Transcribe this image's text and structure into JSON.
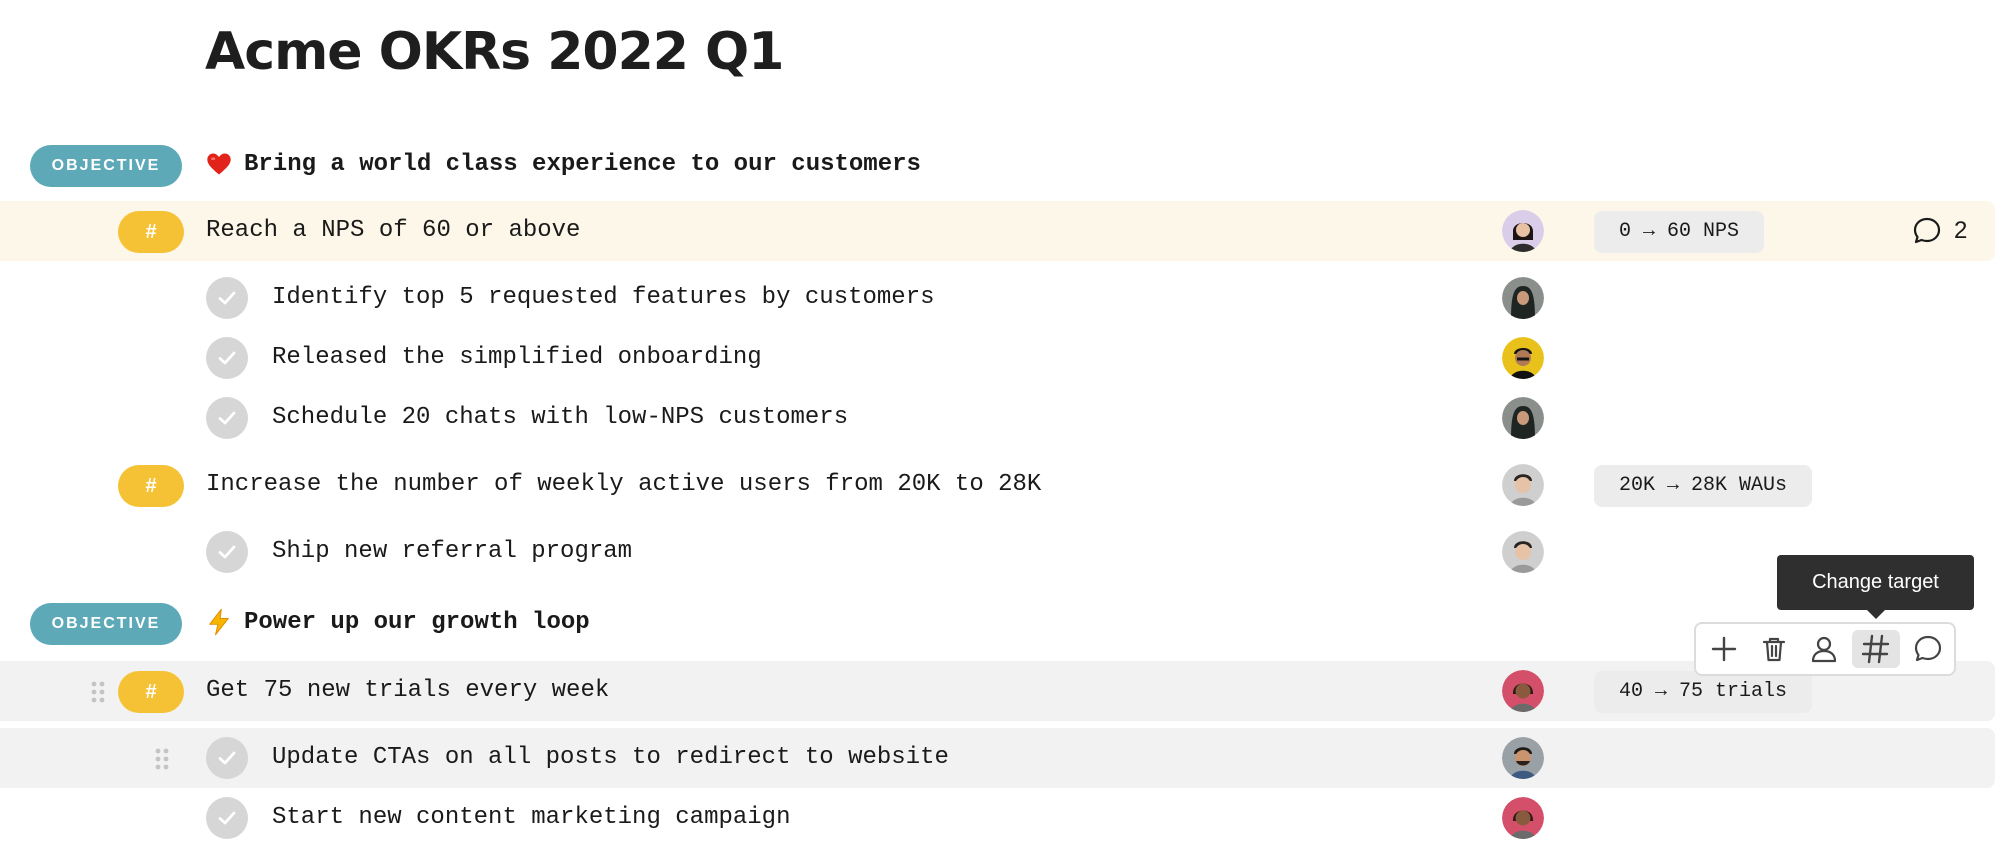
{
  "page": {
    "title": "Acme OKRs 2022 Q1"
  },
  "labels": {
    "objective": "OBJECTIVE",
    "key_result": "#"
  },
  "objectives": [
    {
      "title": "Bring a world class experience to our customers",
      "icon": "heart-icon",
      "key_results": [
        {
          "title": "Reach a NPS of 60 or above",
          "target": "0 → 60 NPS",
          "comments": "2",
          "owner": "avatar-woman-dark-hair",
          "tasks": [
            {
              "title": "Identify top 5 requested features by customers",
              "owner": "avatar-woman-hijab"
            },
            {
              "title": "Released the simplified onboarding",
              "owner": "avatar-man-yellow-bg"
            },
            {
              "title": "Schedule 20 chats with low-NPS customers",
              "owner": "avatar-woman-hijab"
            }
          ]
        },
        {
          "title": "Increase the number of weekly active users from 20K to 28K",
          "target": "20K → 28K WAUs",
          "owner": "avatar-man-smiling",
          "tasks": [
            {
              "title": "Ship new referral program",
              "owner": "avatar-man-smiling"
            }
          ]
        }
      ]
    },
    {
      "title": "Power up our growth loop",
      "icon": "lightning-icon",
      "key_results": [
        {
          "title": "Get 75 new trials every week",
          "target": "40 → 75 trials",
          "owner": "avatar-woman-red-bg",
          "tasks": [
            {
              "title": "Update CTAs on all posts to redirect to website",
              "owner": "avatar-man-beard"
            },
            {
              "title": "Start new content marketing campaign",
              "owner": "avatar-woman-red-bg"
            }
          ]
        }
      ]
    }
  ],
  "tooltip": {
    "text": "Change target"
  },
  "toolbar": {
    "items": [
      "plus-icon",
      "trash-icon",
      "person-icon",
      "hash-icon",
      "comment-icon"
    ],
    "active": "hash-icon"
  },
  "colors": {
    "objective_pill": "#5ea9b8",
    "key_result_pill": "#f6c235",
    "check": "#d6d6d6",
    "highlight_yellow": "#fcf7e9",
    "highlight_gray": "#f2f2f2",
    "target_chip": "#ececec",
    "tooltip_bg": "#2f2f2f"
  }
}
